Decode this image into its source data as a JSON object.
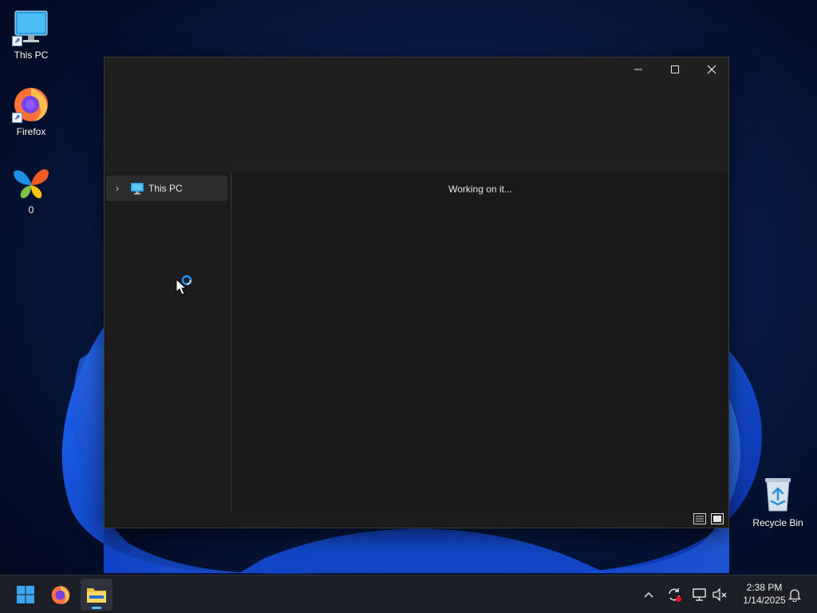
{
  "desktop": {
    "icons": [
      {
        "label": "This PC"
      },
      {
        "label": "Firefox"
      },
      {
        "label": "0"
      },
      {
        "label": "Recycle Bin"
      }
    ]
  },
  "window": {
    "nav_pane": {
      "items": [
        {
          "label": "This PC",
          "expand_glyph": "›"
        }
      ]
    },
    "content": {
      "status_text": "Working on it..."
    }
  },
  "taskbar": {
    "clock": {
      "time": "2:38 PM",
      "date": "1/14/2025"
    },
    "tray_overflow_glyph": "^"
  },
  "colors": {
    "accent": "#4cc2ff",
    "window_bg": "#1c1c1c",
    "titlebar_bg": "#202020",
    "taskbar_bg": "#1c1f26"
  }
}
